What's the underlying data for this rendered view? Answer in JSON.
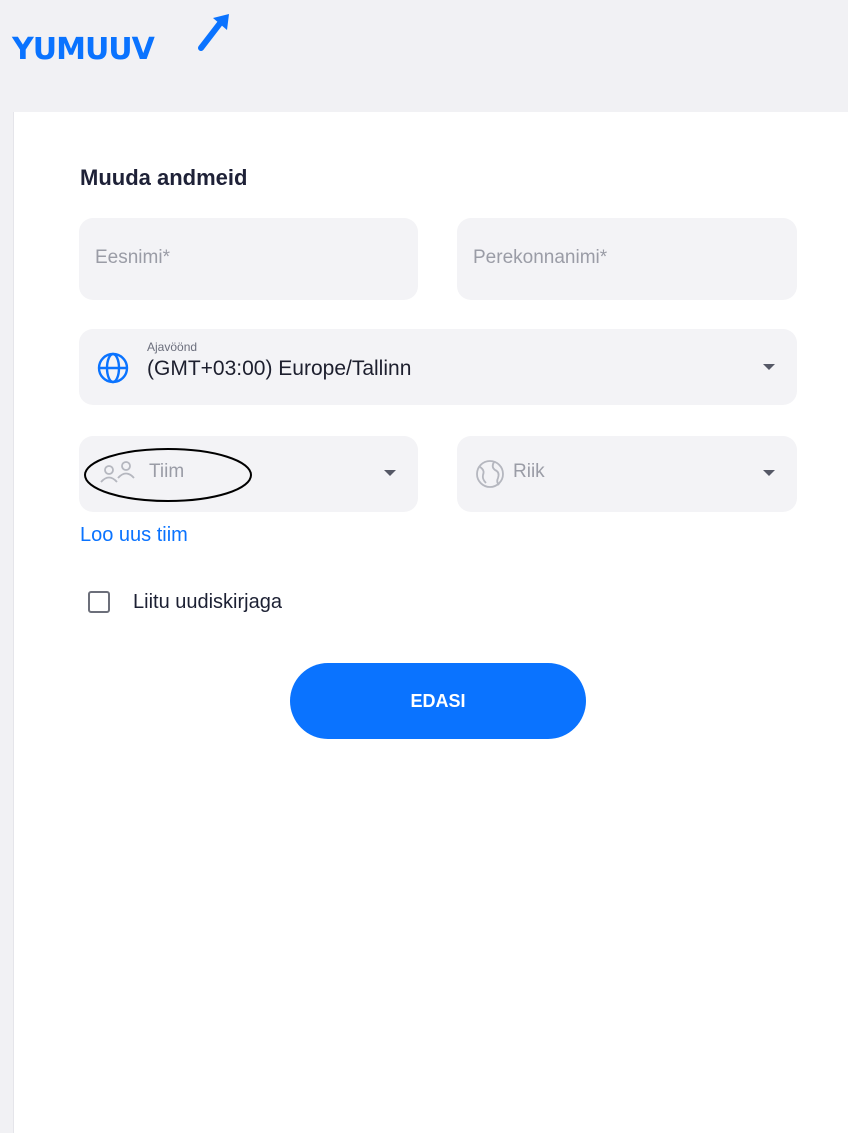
{
  "brand": {
    "logo_text": "YUMUUV",
    "color": "#0a73ff"
  },
  "form": {
    "title": "Muuda andmeid",
    "first_name": {
      "placeholder": "Eesnimi",
      "required_mark": "*"
    },
    "last_name": {
      "placeholder": "Perekonnanimi",
      "required_mark": "*"
    },
    "timezone": {
      "label": "Ajavöönd",
      "value": "(GMT+03:00) Europe/Tallinn",
      "icon": "globe-icon"
    },
    "team": {
      "placeholder": "Tiim",
      "icon": "users-icon"
    },
    "country": {
      "placeholder": "Riik",
      "icon": "earth-icon"
    },
    "create_team_link": "Loo uus tiim",
    "newsletter": {
      "label": "Liitu uudiskirjaga",
      "checked": false
    },
    "submit_label": "EDASI"
  },
  "colors": {
    "accent": "#0a73ff",
    "field_bg": "#f3f3f6",
    "annotation": "#000000"
  }
}
